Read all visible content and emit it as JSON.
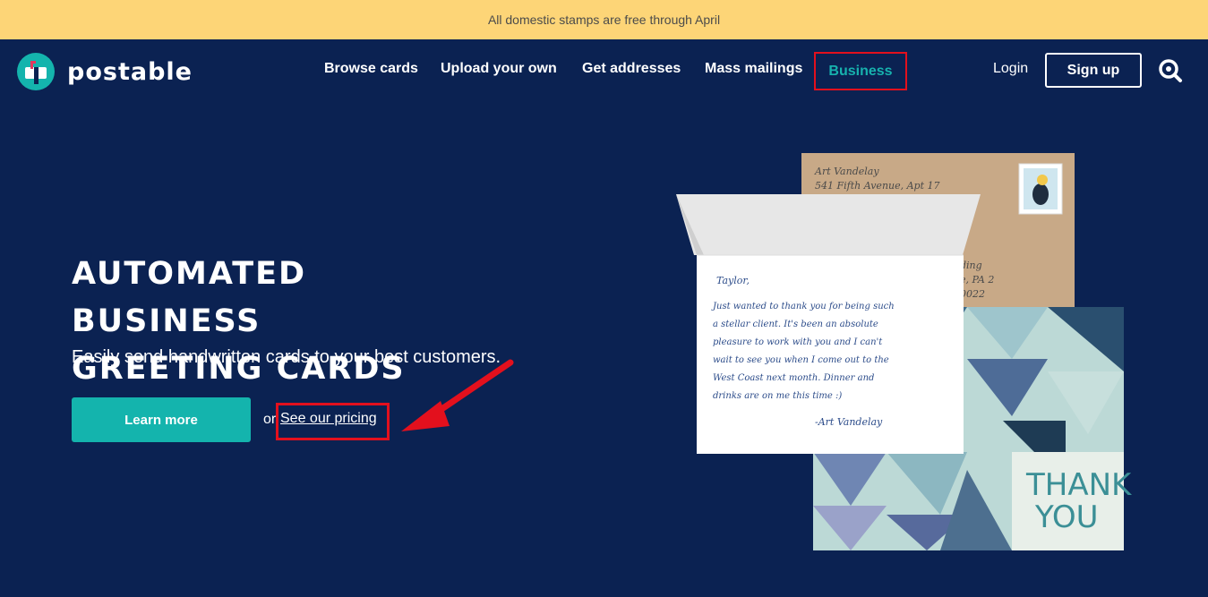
{
  "banner": {
    "text": "All domestic stamps are free through April"
  },
  "brand": {
    "name": "postable",
    "accent": "#14b4ad",
    "navy": "#0b2252",
    "banner_color": "#fdd577",
    "highlight": "#e3101d"
  },
  "nav": {
    "links": [
      "Browse cards",
      "Upload your own",
      "Get addresses",
      "Mass mailings"
    ],
    "business": "Business",
    "login": "Login",
    "signup": "Sign up",
    "search_icon": "search-icon"
  },
  "hero": {
    "title_line1": "AUTOMATED BUSINESS",
    "title_line2": "GREETING CARDS",
    "subtitle": "Easily send handwritten cards to your best customers.",
    "cta": "Learn more",
    "or": "or",
    "pricing_link": "See our pricing"
  },
  "card_image": {
    "envelope_line1": "Art Vandelay",
    "envelope_line2": "541 Fifth Avenue, Apt 17",
    "envelope_frag1": "ding",
    "envelope_frag2": "e, PA 2",
    "envelope_frag3": "0022",
    "note_greeting": "Taylor,",
    "note_lines": [
      "Just wanted to thank you for being such",
      "a stellar client. It's been an absolute",
      "pleasure to work with you and I can't",
      "wait to see you when I come out to the",
      "West Coast next month. Dinner and",
      "drinks are on me this time :)"
    ],
    "note_signature": "-Art Vandelay",
    "card_text1": "THANK",
    "card_text2": "YOU"
  }
}
